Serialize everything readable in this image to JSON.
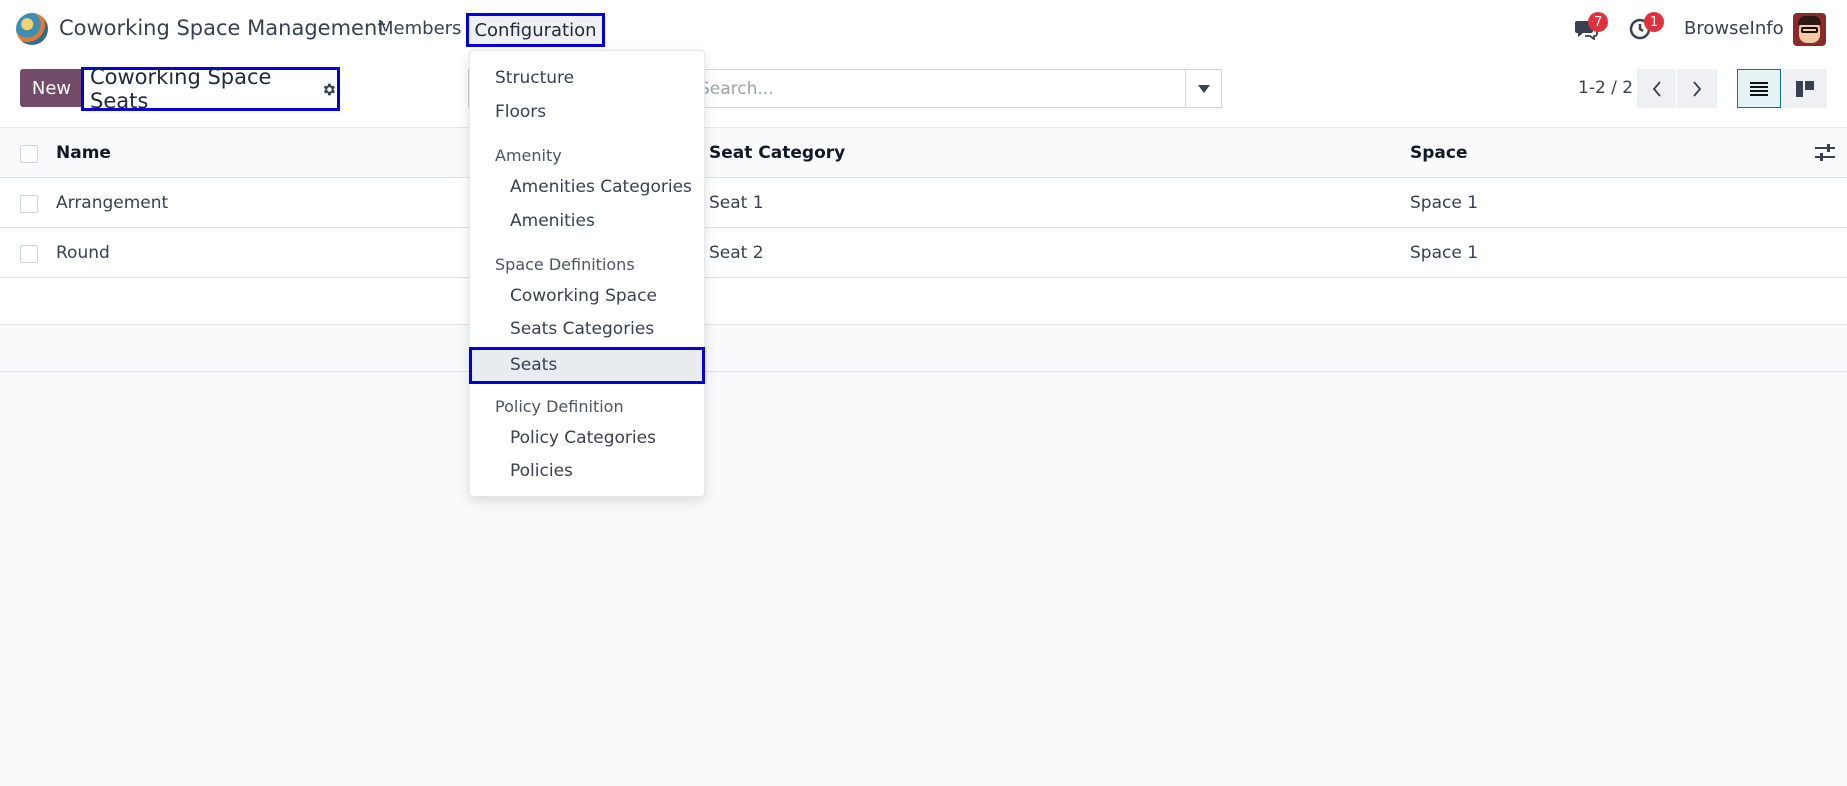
{
  "navbar": {
    "app_title": "Coworking Space Management",
    "menu": {
      "members": "Members",
      "configuration": "Configuration"
    },
    "messages_badge": "7",
    "activities_badge": "1",
    "company": "BrowseInfo"
  },
  "control_panel": {
    "new_label": "New",
    "breadcrumb": "Coworking Space Seats",
    "search_placeholder": "Search...",
    "pager": "1-2 / 2"
  },
  "table": {
    "columns": {
      "name": "Name",
      "seat_category": "Seat Category",
      "space": "Space"
    },
    "rows": [
      {
        "name": "Arrangement",
        "seat_category": "Seat 1",
        "space": "Space 1"
      },
      {
        "name": "Round",
        "seat_category": "Seat 2",
        "space": "Space 1"
      }
    ]
  },
  "config_menu": {
    "structure": "Structure",
    "floors": "Floors",
    "amenity_header": "Amenity",
    "amenities_categories": "Amenities Categories",
    "amenities": "Amenities",
    "space_definitions_header": "Space Definitions",
    "coworking_space": "Coworking Space",
    "seats_categories": "Seats Categories",
    "seats": "Seats",
    "policy_definition_header": "Policy Definition",
    "policy_categories": "Policy Categories",
    "policies": "Policies"
  },
  "colors": {
    "brand": "#714b67",
    "highlight_border": "#0000dd",
    "badge": "#e0323d"
  }
}
